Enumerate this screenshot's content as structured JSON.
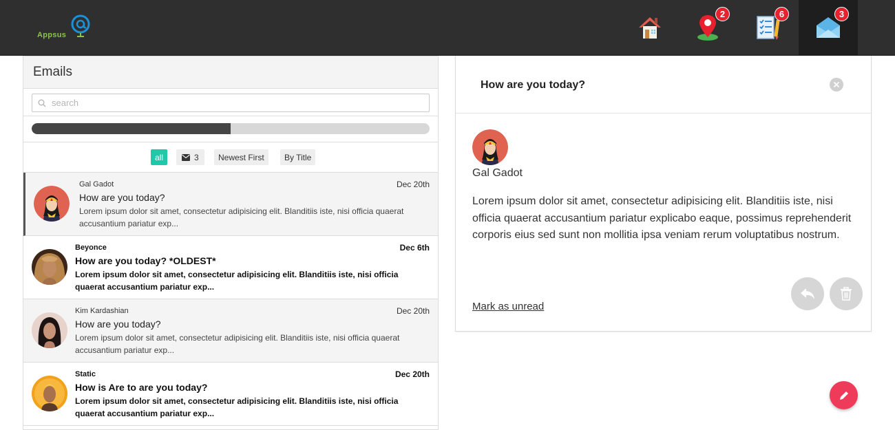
{
  "header": {
    "logo_text": "Appsus",
    "nav": [
      {
        "name": "home",
        "icon": "house-icon",
        "badge": ""
      },
      {
        "name": "maps",
        "icon": "map-pin-icon",
        "badge": "2"
      },
      {
        "name": "notes",
        "icon": "checklist-icon",
        "badge": "6"
      },
      {
        "name": "email",
        "icon": "envelope-icon",
        "badge": "3",
        "active": true
      }
    ]
  },
  "list_panel": {
    "title": "Emails",
    "search_placeholder": "search",
    "read_progress": 0.5,
    "filters": {
      "all": "all",
      "unread_count": "3",
      "sort_date": "Newest First",
      "sort_title": "By Title"
    }
  },
  "emails": [
    {
      "from": "Gal Gadot",
      "date": "Dec 20th",
      "subject": "How are you today?",
      "body": "Lorem ipsum dolor sit amet, consectetur adipisicing elit. Blanditiis iste, nisi officia quaerat accusantium pariatur exp...",
      "read": true,
      "selected": true,
      "avatar": "wonder-woman-avatar"
    },
    {
      "from": "Beyonce",
      "date": "Dec 6th",
      "subject": "How are you today? *OLDEST*",
      "body": "Lorem ipsum dolor sit amet, consectetur adipisicing elit. Blanditiis iste, nisi officia quaerat accusantium pariatur exp...",
      "read": false,
      "selected": false,
      "avatar": "beyonce-photo-avatar"
    },
    {
      "from": "Kim Kardashian",
      "date": "Dec 20th",
      "subject": "How are you today?",
      "body": "Lorem ipsum dolor sit amet, consectetur adipisicing elit. Blanditiis iste, nisi officia quaerat accusantium pariatur exp...",
      "read": true,
      "selected": false,
      "avatar": "kim-photo-avatar"
    },
    {
      "from": "Static",
      "date": "Dec 20th",
      "subject": "How is Are to are you today?",
      "body": "Lorem ipsum dolor sit amet, consectetur adipisicing elit. Blanditiis iste, nisi officia quaerat accusantium pariatur exp...",
      "read": false,
      "selected": false,
      "avatar": "static-photo-avatar"
    }
  ],
  "detail": {
    "subject": "How are you today?",
    "from": "Gal Gadot",
    "body": "Lorem ipsum dolor sit amet, consectetur adipisicing elit. Blanditiis iste, nisi officia quaerat accusantium pariatur explicabo eaque, possimus reprehenderit corporis eius sed sunt non mollitia ipsa veniam rerum voluptatibus nostrum.",
    "mark_unread": "Mark as unread"
  },
  "colors": {
    "header_bg": "#2f2f2f",
    "accent_teal": "#1fc8a8",
    "badge_red": "#e8212f",
    "fab_pink": "#ee3b5a"
  }
}
